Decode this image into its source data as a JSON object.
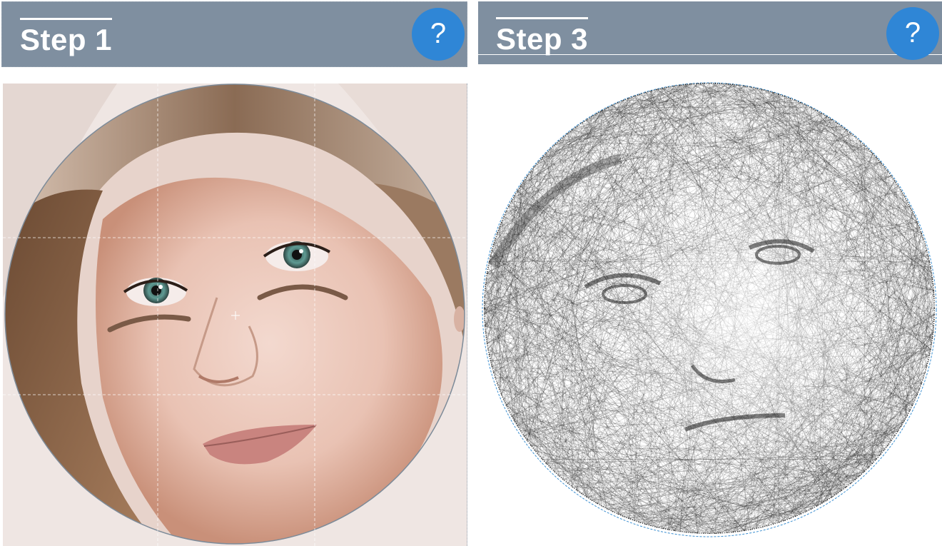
{
  "panels": [
    {
      "title": "Step 1",
      "help_label": "?",
      "image": "portrait-photo",
      "accent": "#2f86d6",
      "header_color": "#7f8fa0"
    },
    {
      "title": "Step 3",
      "help_label": "?",
      "image": "string-art-preview",
      "accent": "#2f86d6",
      "header_color": "#7f8fa0"
    }
  ],
  "icons": {
    "help": "question-mark-icon",
    "crosshair": "crosshair-icon"
  }
}
